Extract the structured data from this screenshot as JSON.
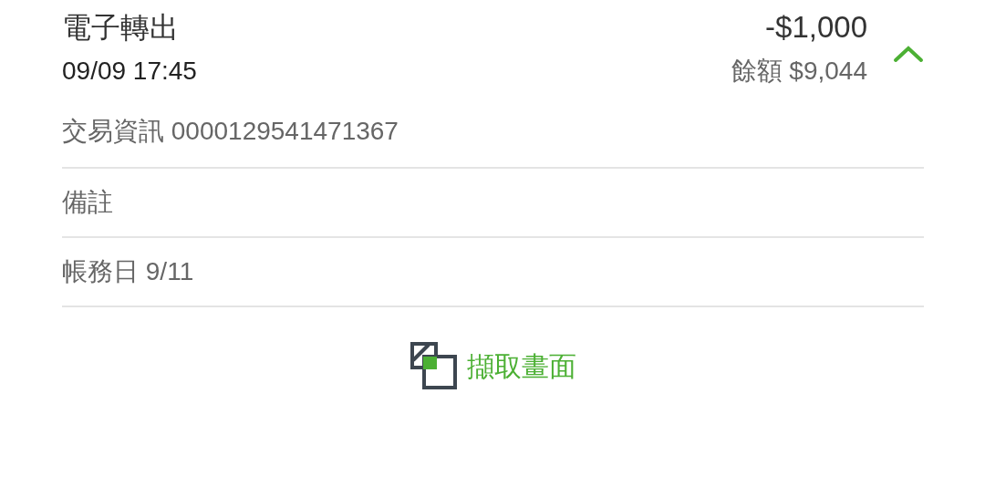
{
  "transaction": {
    "title": "電子轉出",
    "amount": "-$1,000",
    "datetime": "09/09 17:45",
    "balance_label": "餘額",
    "balance": "$9,044",
    "expanded": true
  },
  "details": [
    {
      "label": "交易資訊",
      "value": "0000129541471367"
    },
    {
      "label": "備註"
    },
    {
      "label": "帳務日",
      "value": "9/11"
    }
  ],
  "capture_button": {
    "label": "擷取畫面"
  }
}
